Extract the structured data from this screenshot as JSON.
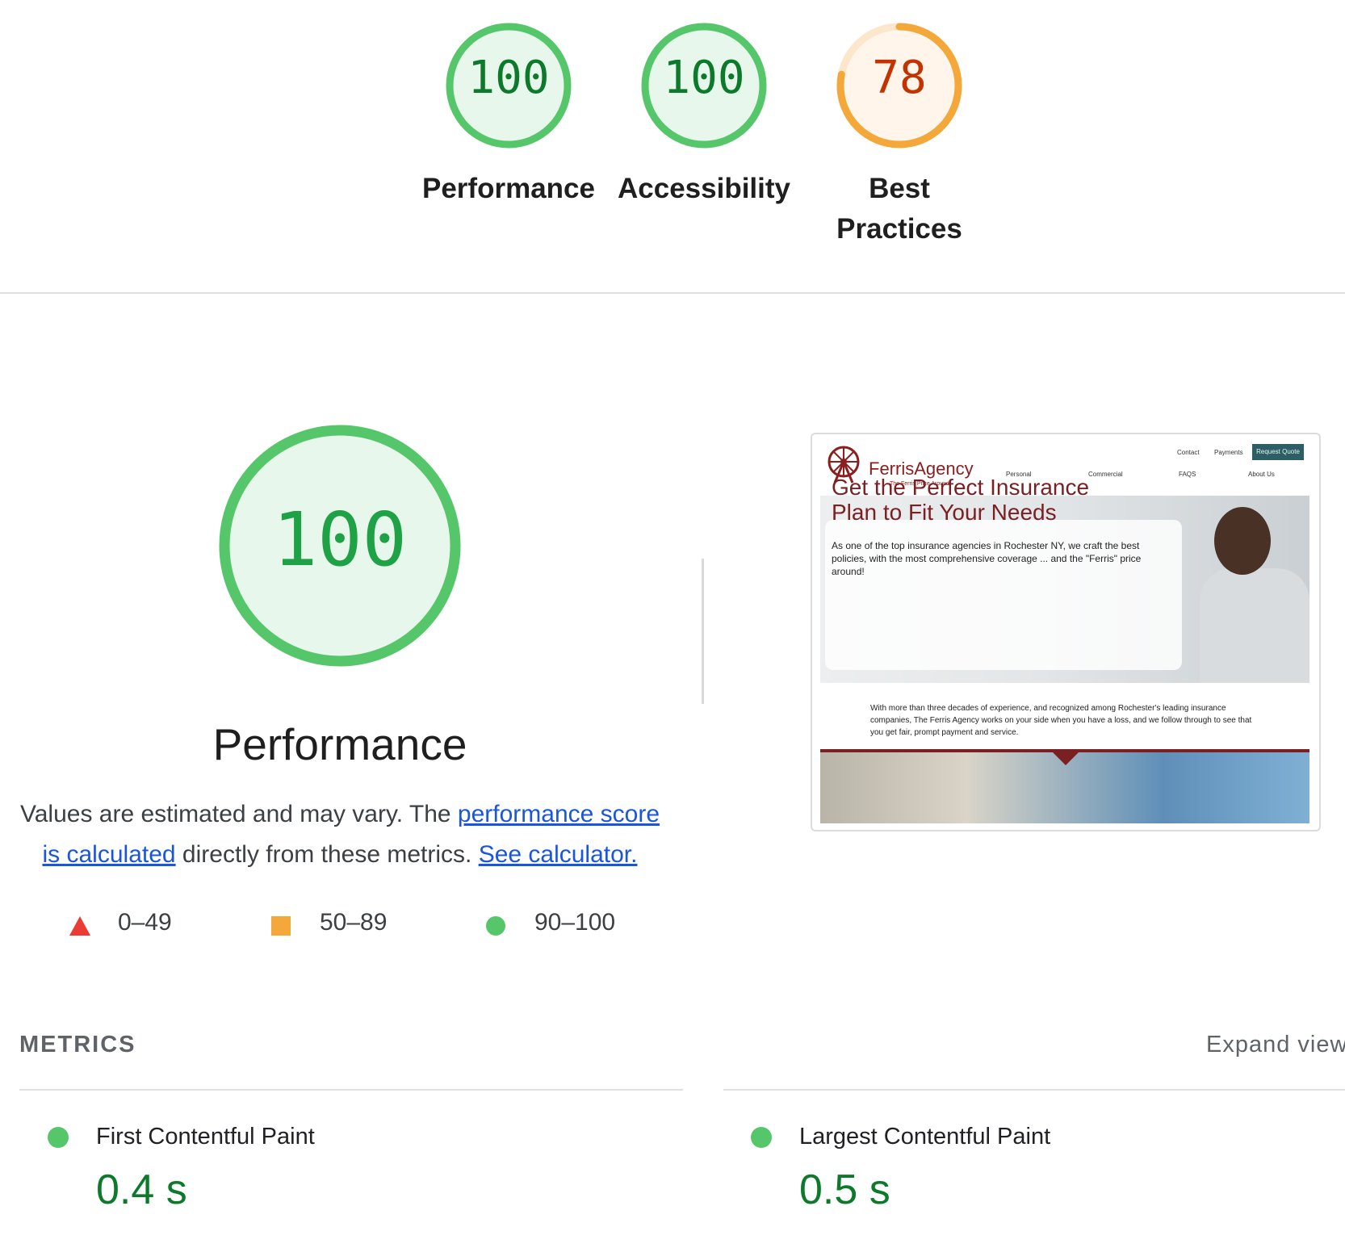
{
  "gauges": [
    {
      "score": "100",
      "label": "Performance",
      "status": "pass"
    },
    {
      "score": "100",
      "label": "Accessibility",
      "status": "pass"
    },
    {
      "score": "78",
      "label_line1": "Best",
      "label_line2": "Practices",
      "status": "average"
    }
  ],
  "performance": {
    "score": "100",
    "title": "Performance",
    "desc_prefix": "Values are estimated and may vary. The ",
    "desc_link1": "performance score is calculated",
    "desc_mid": " directly from these metrics. ",
    "desc_link2": "See calculator."
  },
  "legend": {
    "fail": "0–49",
    "average": "50–89",
    "pass": "90–100"
  },
  "screenshot": {
    "logo_name": "FerrisAgency",
    "logo_tagline": "The Ferris Price Around",
    "nav_top": [
      "Contact",
      "Payments"
    ],
    "nav_button": "Request Quote",
    "nav_main": [
      "Personal",
      "Commercial",
      "FAQS",
      "About Us"
    ],
    "hero_title": "Get the Perfect Insurance Plan to Fit Your Needs",
    "hero_body": "As one of the top insurance agencies in Rochester NY, we craft the best policies, with the most comprehensive coverage ... and the \"Ferris\" price around!",
    "intro": "With more than three decades of experience, and recognized among Rochester's leading insurance companies, The Ferris Agency works on your side when you have a loss, and we follow through to see that you get fair, prompt payment and service."
  },
  "metrics": {
    "heading": "METRICS",
    "expand": "Expand view",
    "items": [
      {
        "title": "First Contentful Paint",
        "value": "0.4 s"
      },
      {
        "title": "Largest Contentful Paint",
        "value": "0.5 s"
      }
    ]
  },
  "colors": {
    "pass": "#0c7a2a",
    "pass_ring": "#55c76a",
    "average": "#c33300",
    "average_ring": "#f4a83a",
    "fail": "#ea3b35",
    "link": "#1a56db"
  }
}
